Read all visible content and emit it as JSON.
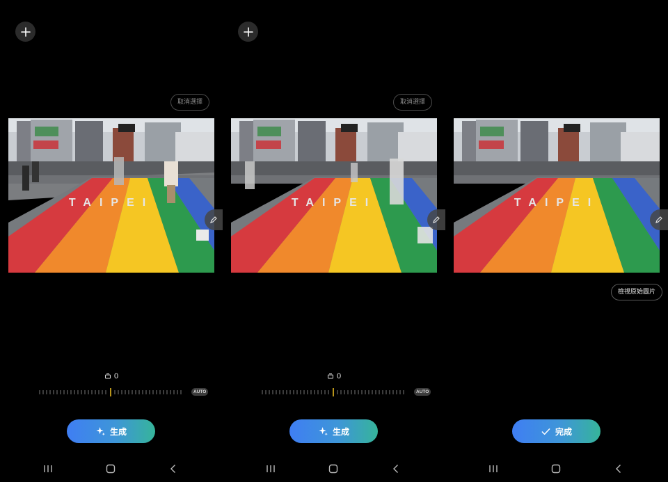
{
  "panels": [
    {
      "add_icon": "plus-icon",
      "deselect_label": "取消選擇",
      "dial_value": "0",
      "auto_label": "AUTO",
      "action_label": "生成",
      "action_icon": "sparkle-icon"
    },
    {
      "add_icon": "plus-icon",
      "deselect_label": "取消選擇",
      "dial_value": "0",
      "auto_label": "AUTO",
      "action_label": "生成",
      "action_icon": "sparkle-icon"
    },
    {
      "add_icon": "plus-icon",
      "view_original_label": "檢視原始圖片",
      "action_label": "完成",
      "action_icon": "check-icon"
    }
  ],
  "photo": {
    "road_text": "TAIPEI",
    "stripe_colors": [
      "#d63a3f",
      "#f0892c",
      "#f5c623",
      "#2d9a4e",
      "#3a63c9"
    ]
  },
  "navbar": {
    "icons": [
      "recent-apps-icon",
      "home-icon",
      "back-icon"
    ]
  },
  "colors": {
    "background": "#000000",
    "button_gradient_start": "#3f7ef3",
    "button_gradient_end": "#36b49a",
    "dial_marker": "#f5c623"
  }
}
